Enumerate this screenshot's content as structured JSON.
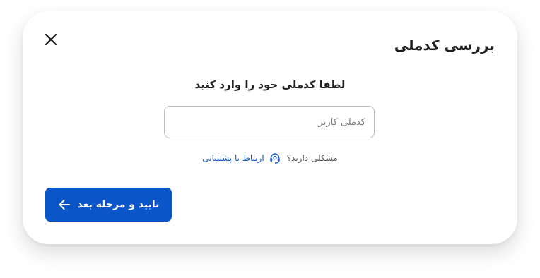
{
  "dialog": {
    "title": "بررسی کدملی",
    "close_icon": "close-icon"
  },
  "form": {
    "prompt": "لطفا کدملی خود را وارد کنید",
    "national_id": {
      "placeholder": "کدملی کاربر",
      "value": ""
    }
  },
  "help": {
    "question": "مشکلی دارید؟",
    "support_link": "ارتباط با پشتیبانی",
    "support_icon": "headset-icon"
  },
  "actions": {
    "submit_label": "تایید و مرحله بعد",
    "submit_icon": "arrow-left-icon"
  },
  "colors": {
    "primary": "#0a56c9",
    "link": "#1f5fbf",
    "text": "#222222"
  }
}
